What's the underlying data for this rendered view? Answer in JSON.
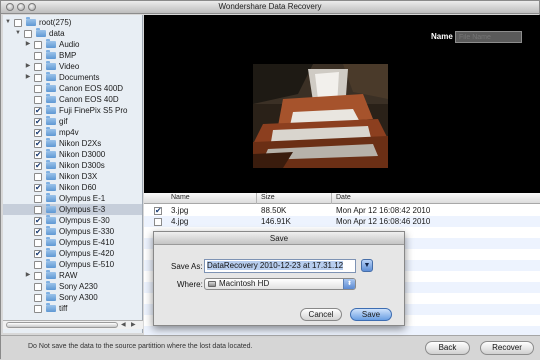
{
  "window": {
    "title": "Wondershare Data Recovery"
  },
  "tree": [
    {
      "label": "root(275)",
      "checked": false,
      "disclosure": "open",
      "indent": 0
    },
    {
      "label": "data",
      "checked": false,
      "disclosure": "open",
      "indent": 1
    },
    {
      "label": "Audio",
      "checked": false,
      "disclosure": "closed",
      "indent": 2
    },
    {
      "label": "BMP",
      "checked": false,
      "disclosure": "",
      "indent": 2
    },
    {
      "label": "Video",
      "checked": false,
      "disclosure": "closed",
      "indent": 2
    },
    {
      "label": "Documents",
      "checked": false,
      "disclosure": "closed",
      "indent": 2
    },
    {
      "label": "Canon EOS 400D",
      "checked": false,
      "disclosure": "",
      "indent": 2
    },
    {
      "label": "Canon EOS 40D",
      "checked": false,
      "disclosure": "",
      "indent": 2
    },
    {
      "label": "Fuji FinePix S5 Pro",
      "checked": true,
      "disclosure": "",
      "indent": 2
    },
    {
      "label": "gif",
      "checked": true,
      "disclosure": "",
      "indent": 2
    },
    {
      "label": "mp4v",
      "checked": true,
      "disclosure": "",
      "indent": 2
    },
    {
      "label": "Nikon D2Xs",
      "checked": true,
      "disclosure": "",
      "indent": 2
    },
    {
      "label": "Nikon D3000",
      "checked": true,
      "disclosure": "",
      "indent": 2
    },
    {
      "label": "Nikon D300s",
      "checked": true,
      "disclosure": "",
      "indent": 2
    },
    {
      "label": "Nikon D3X",
      "checked": false,
      "disclosure": "",
      "indent": 2
    },
    {
      "label": "Nikon D60",
      "checked": true,
      "disclosure": "",
      "indent": 2
    },
    {
      "label": "Olympus E-1",
      "checked": false,
      "disclosure": "",
      "indent": 2
    },
    {
      "label": "Olympus E-3",
      "checked": false,
      "disclosure": "",
      "indent": 2,
      "selected": true
    },
    {
      "label": "Olympus E-30",
      "checked": true,
      "disclosure": "",
      "indent": 2
    },
    {
      "label": "Olympus E-330",
      "checked": true,
      "disclosure": "",
      "indent": 2
    },
    {
      "label": "Olympus E-410",
      "checked": false,
      "disclosure": "",
      "indent": 2
    },
    {
      "label": "Olympus E-420",
      "checked": true,
      "disclosure": "",
      "indent": 2
    },
    {
      "label": "Olympus E-510",
      "checked": false,
      "disclosure": "",
      "indent": 2
    },
    {
      "label": "RAW",
      "checked": false,
      "disclosure": "closed",
      "indent": 2
    },
    {
      "label": "Sony A230",
      "checked": false,
      "disclosure": "",
      "indent": 2
    },
    {
      "label": "Sony A300",
      "checked": false,
      "disclosure": "",
      "indent": 2
    },
    {
      "label": "tiff",
      "checked": false,
      "disclosure": "",
      "indent": 2
    }
  ],
  "preview": {
    "name_label": "Name",
    "name_placeholder": "File Name"
  },
  "table": {
    "columns": [
      "Name",
      "Size",
      "Date"
    ],
    "rows": [
      {
        "checked": true,
        "name": "3.jpg",
        "size": "88.50K",
        "date": "Mon Apr 12 16:08:42 2010"
      },
      {
        "checked": false,
        "name": "4.jpg",
        "size": "146.91K",
        "date": "Mon Apr 12 16:08:46 2010"
      }
    ]
  },
  "dialog": {
    "title": "Save",
    "save_as_label": "Save As:",
    "save_as_value": "DataRecovery 2010-12-23 at 17.31.12",
    "where_label": "Where:",
    "where_value": "Macintosh HD",
    "cancel_label": "Cancel",
    "save_label": "Save"
  },
  "footer": {
    "notice": "Do Not save the data to the source partittion where the lost data located.",
    "back_label": "Back",
    "recover_label": "Recover"
  },
  "colors": {
    "preview_bg": "#000000",
    "selection": "#c6ceda",
    "accent_button": "#6a9fe3"
  }
}
